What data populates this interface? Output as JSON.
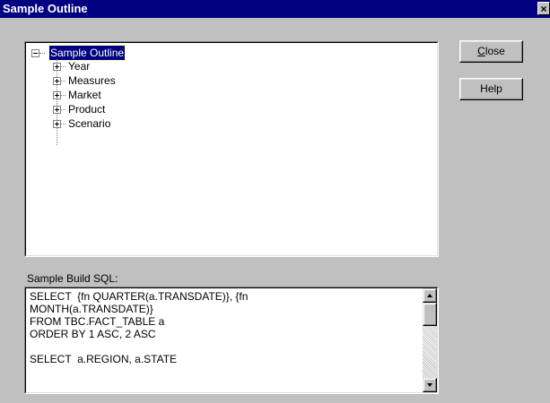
{
  "window": {
    "title": "Sample Outline",
    "close_glyph": "×"
  },
  "tree": {
    "root": {
      "label": "Sample Outline",
      "expanded": true,
      "selected": true
    },
    "children": [
      {
        "label": "Year",
        "expanded": false
      },
      {
        "label": "Measures",
        "expanded": false
      },
      {
        "label": "Market",
        "expanded": false
      },
      {
        "label": "Product",
        "expanded": false
      },
      {
        "label": "Scenario",
        "expanded": false
      }
    ]
  },
  "buttons": {
    "close": {
      "label": "Close",
      "mnemonic": "C",
      "rest": "lose"
    },
    "help": {
      "label": "Help"
    }
  },
  "sql": {
    "label": "Sample Build SQL:",
    "text": "SELECT  {fn QUARTER(a.TRANSDATE)}, {fn\nMONTH(a.TRANSDATE)}\nFROM TBC.FACT_TABLE a\nORDER BY 1 ASC, 2 ASC\n\nSELECT  a.REGION, a.STATE"
  },
  "colors": {
    "titlebar": "#000080",
    "face": "#c0c0c0",
    "selection": "#000080"
  }
}
